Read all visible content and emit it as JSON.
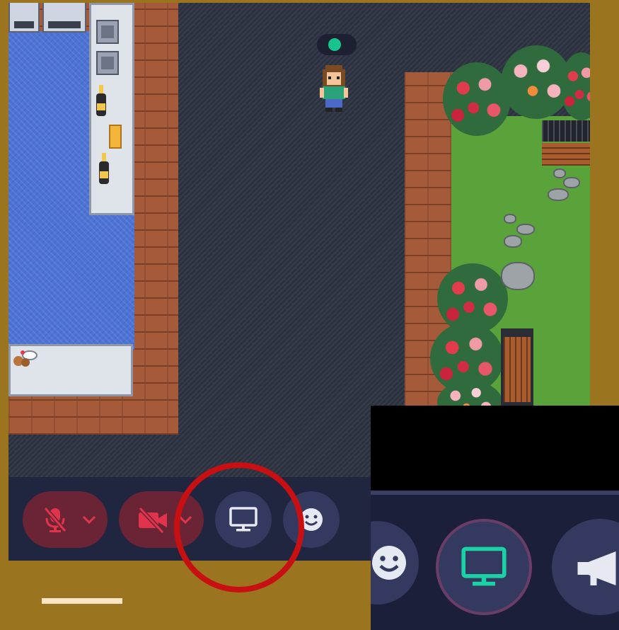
{
  "scene": {
    "avatar_status": "online",
    "colors": {
      "page_background": "#9b7420",
      "toolbar_background": "#202540",
      "button_background": "#343a5f",
      "muted_background": "#6b2435",
      "muted_icon": "#e0334c",
      "active_icon": "#1ad2a5",
      "status_online": "#17c48d",
      "highlight_ring": "#c80f12"
    }
  },
  "toolbar": {
    "microphone": {
      "icon": "microphone-off-icon",
      "state": "muted",
      "dropdown_icon": "chevron-down-icon"
    },
    "camera": {
      "icon": "camera-off-icon",
      "state": "off",
      "dropdown_icon": "chevron-down-icon"
    },
    "screen_share": {
      "icon": "monitor-icon"
    },
    "emoji": {
      "icon": "smiley-icon"
    }
  },
  "zoom_inset": {
    "buttons": [
      {
        "icon": "smiley-icon",
        "state": "idle"
      },
      {
        "icon": "monitor-icon",
        "state": "active"
      },
      {
        "icon": "megaphone-icon",
        "state": "idle"
      }
    ]
  }
}
